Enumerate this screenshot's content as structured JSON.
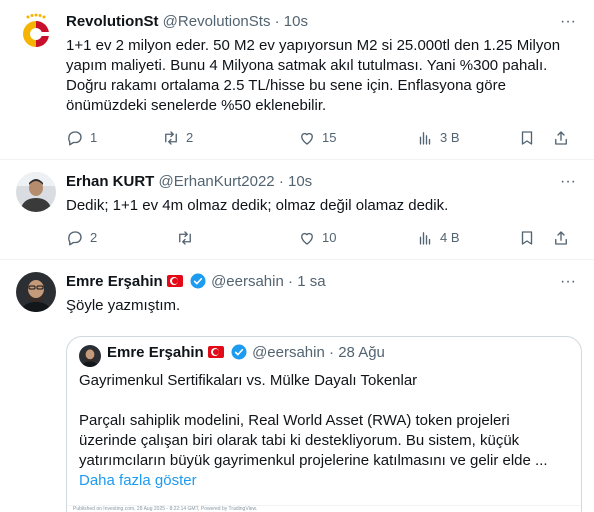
{
  "tweets": [
    {
      "name": "RevolutionSt",
      "handle": "@RevolutionSts",
      "time": "10s",
      "text": "1+1 ev 2 milyon eder. 50 M2 ev yapıyorsun M2 si 25.000tl den 1.25 Milyon yapım maliyeti. Bunu 4 Milyona satmak akıl tutulması. Yani %300 pahalı. Doğru rakamı ortalama 2.5 TL/hisse bu sene için. Enflasyona göre önümüzdeki senelerde %50 eklenebilir.",
      "replies": "1",
      "retweets": "2",
      "likes": "15",
      "views": "3 B"
    },
    {
      "name": "Erhan KURT",
      "handle": "@ErhanKurt2022",
      "time": "10s",
      "text": "Dedik; 1+1 ev 4m olmaz dedik; olmaz değil olamaz dedik.",
      "replies": "2",
      "retweets": "",
      "likes": "10",
      "views": "4 B"
    },
    {
      "name": "Emre Erşahin",
      "handle": "@eersahin",
      "time": "1 sa",
      "text": "Şöyle yazmıştım."
    }
  ],
  "quote": {
    "name": "Emre Erşahin",
    "handle": "@eersahin",
    "time": "28 Ağu",
    "title": "Gayrimenkul Sertifikaları vs. Mülke Dayalı Tokenlar",
    "body": "Parçalı sahiplik modelini, Real World Asset (RWA) token projeleri üzerinde çalışan biri olarak tabi ki destekliyorum. Bu sistem, küçük yatırımcıların büyük gayrimenkul projelerine katılmasını ve gelir elde ...",
    "show_more": "Daha fazla göster",
    "footer_note": "Published on Investing.com, 28 Aug 2025 - 8:22:14 GMT, Powered by TradingView."
  },
  "separator": "·",
  "more_glyph": "···",
  "colors": {
    "accent": "#1d9bf0",
    "muted": "#536471",
    "border": "#eff3f4"
  },
  "icons": [
    "reply-icon",
    "retweet-icon",
    "like-icon",
    "views-icon",
    "bookmark-icon",
    "share-icon",
    "verified-icon",
    "turkey-flag-icon",
    "more-icon"
  ]
}
